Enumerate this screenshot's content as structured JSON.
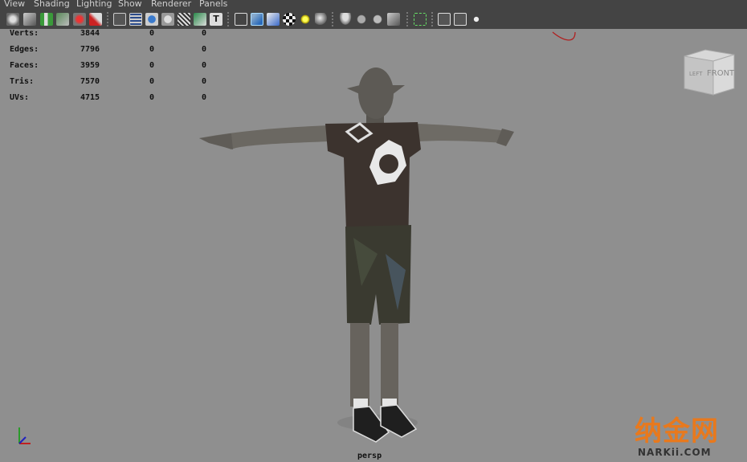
{
  "menu": {
    "view": "View",
    "shading": "Shading",
    "lighting": "Lighting",
    "show": "Show",
    "renderer": "Renderer",
    "panels": "Panels"
  },
  "hud": {
    "rows": [
      {
        "label": "Verts:",
        "v1": "3844",
        "v2": "0",
        "v3": "0"
      },
      {
        "label": "Edges:",
        "v1": "7796",
        "v2": "0",
        "v3": "0"
      },
      {
        "label": "Faces:",
        "v1": "3959",
        "v2": "0",
        "v3": "0"
      },
      {
        "label": "Tris:",
        "v1": "7570",
        "v2": "0",
        "v3": "0"
      },
      {
        "label": "UVs:",
        "v1": "4715",
        "v2": "0",
        "v3": "0"
      }
    ]
  },
  "viewcube": {
    "left": "LEFT",
    "front": "FRONT"
  },
  "camera": {
    "name": "persp"
  },
  "watermark": {
    "cn": "纳金网",
    "en": "NARKii.COM"
  },
  "toolbar_icons": [
    "camera-select-icon",
    "camera-attrs-icon",
    "bookmark-icon",
    "image-plane-icon",
    "grid-icon",
    "film-gate-icon",
    "resolution-gate-icon",
    "gate-mask-icon",
    "field-chart-icon",
    "safe-action-icon",
    "safe-title-icon",
    "wireframe-icon",
    "smooth-shade-icon",
    "wireframe-on-shaded-icon",
    "textured-icon",
    "default-light-icon",
    "all-lights-icon",
    "shadows-icon",
    "ambient-occlusion-icon",
    "xray-icon",
    "xray-joints-icon",
    "backface-icon",
    "isolate-select-icon",
    "xray-active-icon",
    "hud-icon",
    "texture-display-icon",
    "resolution-icon"
  ],
  "colors": {
    "menubar": "#444444",
    "viewport": "#8f8f8f",
    "watermark_orange": "#e8791d"
  }
}
